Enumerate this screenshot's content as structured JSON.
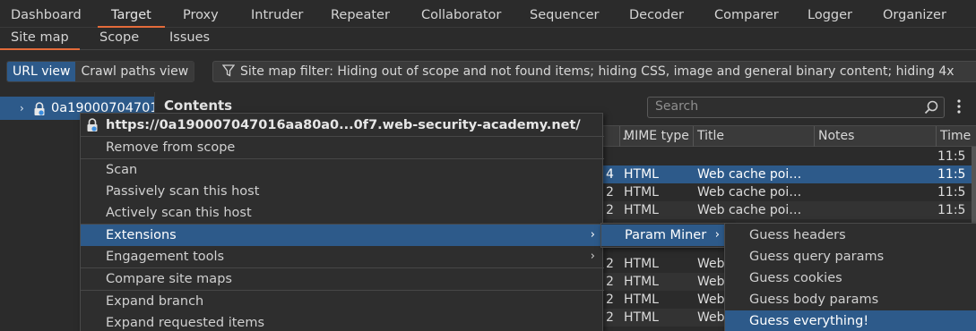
{
  "top_tabs": [
    {
      "label": "Dashboard"
    },
    {
      "label": "Target"
    },
    {
      "label": "Proxy"
    },
    {
      "label": "Intruder"
    },
    {
      "label": "Repeater"
    },
    {
      "label": "Collaborator"
    },
    {
      "label": "Sequencer"
    },
    {
      "label": "Decoder"
    },
    {
      "label": "Comparer"
    },
    {
      "label": "Logger"
    },
    {
      "label": "Organizer"
    }
  ],
  "active_top_tab": "Target",
  "sub_tabs": [
    {
      "label": "Site map"
    },
    {
      "label": "Scope"
    },
    {
      "label": "Issues"
    }
  ],
  "active_sub_tab": "Site map",
  "toolbar": {
    "url_view": "URL view",
    "crawl_paths_view": "Crawl paths view",
    "filter_text": "Site map filter: Hiding out of scope and not found items;  hiding CSS, image and general binary content;  hiding 4x"
  },
  "tree": {
    "host_label": "0a190007047016aa80a0"
  },
  "contents": {
    "title": "Contents",
    "search_placeholder": "Search",
    "columns": {
      "status": "…",
      "mime": "MIME type",
      "title": "Title",
      "notes": "Notes",
      "time": "Time"
    },
    "rows": [
      {
        "status": "",
        "mime": "",
        "title": "",
        "time": "11:5"
      },
      {
        "status": "4",
        "mime": "HTML",
        "title": "Web cache poi…",
        "time": "11:5"
      },
      {
        "status": "2",
        "mime": "HTML",
        "title": "Web cache poi…",
        "time": "11:5"
      },
      {
        "status": "2",
        "mime": "HTML",
        "title": "Web cache poi…",
        "time": "11:5"
      },
      {
        "status": "",
        "mime": "",
        "title": "",
        "time": ""
      },
      {
        "status": "2",
        "mime": "HTML",
        "title": "Web",
        "time": ""
      },
      {
        "status": "2",
        "mime": "HTML",
        "title": "Web",
        "time": ""
      },
      {
        "status": "2",
        "mime": "HTML",
        "title": "Web",
        "time": ""
      },
      {
        "status": "2",
        "mime": "HTML",
        "title": "Web",
        "time": ""
      }
    ]
  },
  "context_menu": {
    "header": "https://0a190007047016aa80a0...0f7.web-security-academy.net/",
    "items": [
      {
        "label": "Remove from scope"
      },
      {
        "label": "Scan"
      },
      {
        "label": "Passively scan this host"
      },
      {
        "label": "Actively scan this host"
      },
      {
        "label": "Extensions"
      },
      {
        "label": "Engagement tools"
      },
      {
        "label": "Compare site maps"
      },
      {
        "label": "Expand branch"
      },
      {
        "label": "Expand requested items"
      }
    ]
  },
  "extensions_submenu": {
    "items": [
      {
        "label": "Param Miner"
      }
    ]
  },
  "param_miner_submenu": {
    "items": [
      {
        "label": "Guess headers"
      },
      {
        "label": "Guess query params"
      },
      {
        "label": "Guess cookies"
      },
      {
        "label": "Guess body params"
      },
      {
        "label": "Guess everything!"
      }
    ]
  },
  "colors": {
    "accent": "#e36b3a",
    "selection": "#2d5a8a",
    "background": "#2b2b2b"
  }
}
